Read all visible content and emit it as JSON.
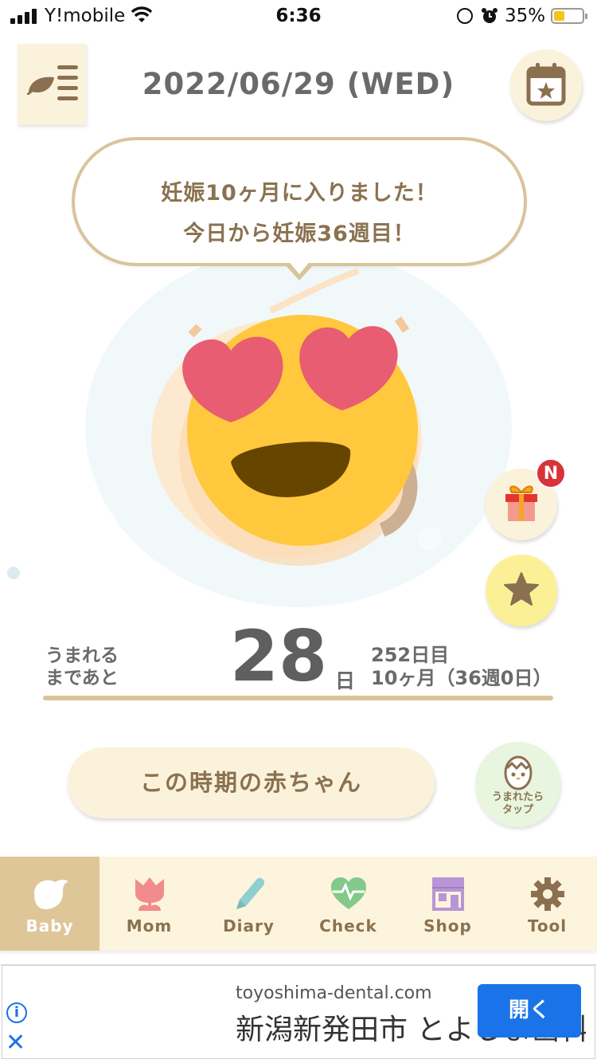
{
  "status_bar": {
    "carrier": "Y!mobile",
    "time": "6:36",
    "battery_percent": "35%",
    "battery_level": 0.35,
    "icons": [
      "signal-icon",
      "wifi-icon",
      "rotation-lock-icon",
      "alarm-icon",
      "battery-icon"
    ]
  },
  "header": {
    "date": "2022/06/29 (WED)",
    "menu_icon": "leaf-menu-icon",
    "calendar_icon": "calendar-star-icon"
  },
  "bubble": {
    "line1": "妊娠10ヶ月に入りました！",
    "line2": "今日から妊娠36週目！"
  },
  "side_buttons": {
    "gift_icon": "gift-icon",
    "new_badge": "N",
    "star_icon": "star-icon"
  },
  "countdown": {
    "label_line1": "うまれる",
    "label_line2": "まであと",
    "days": "28",
    "days_unit": "日",
    "day_count": "252日目",
    "month_week": "10ヶ月（36週0日）"
  },
  "baby_info_button": "この時期の赤ちゃん",
  "born_button": {
    "line1": "うまれたら",
    "line2": "タップ",
    "icon": "hatching-egg-icon"
  },
  "tabs": [
    {
      "label": "Baby",
      "icon": "bird-icon",
      "active": true
    },
    {
      "label": "Mom",
      "icon": "tulip-icon",
      "active": false
    },
    {
      "label": "Diary",
      "icon": "pencil-icon",
      "active": false
    },
    {
      "label": "Check",
      "icon": "heartbeat-icon",
      "active": false
    },
    {
      "label": "Shop",
      "icon": "shop-icon",
      "active": false
    },
    {
      "label": "Tool",
      "icon": "gear-icon",
      "active": false
    }
  ],
  "ad": {
    "domain": "toyoshima-dental.com",
    "headline": "新潟新発田市 とよしま歯科",
    "button": "開く",
    "info_icon": "i",
    "close_icon": "✕"
  },
  "colors": {
    "accent": "#8a7250",
    "cream": "#fbf2dc",
    "tab_active": "#dec699",
    "ad_button": "#1a73e8",
    "badge": "#d7343a"
  }
}
